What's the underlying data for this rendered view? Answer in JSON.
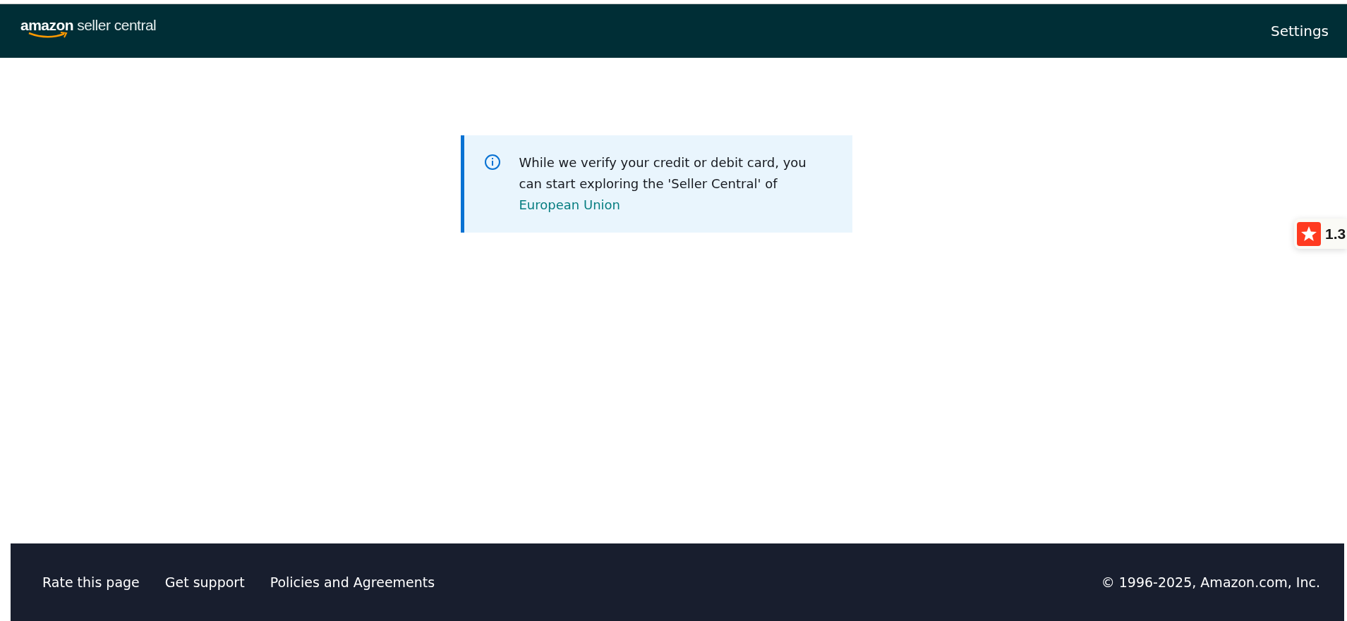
{
  "header": {
    "logo": {
      "brand": "amazon",
      "product": "seller central"
    },
    "settings_link": "Settings"
  },
  "notice": {
    "kind": "info",
    "lines": [
      "While we verify your credit or debit card, you",
      "can start exploring the 'Seller Central' of"
    ],
    "link": "European Union"
  },
  "rating_badge": {
    "value": "1.3"
  },
  "footer": {
    "links": [
      "Rate this page",
      "Get support",
      "Policies and Agreements"
    ],
    "copyright": "© 1996-2025, Amazon.com, Inc."
  }
}
